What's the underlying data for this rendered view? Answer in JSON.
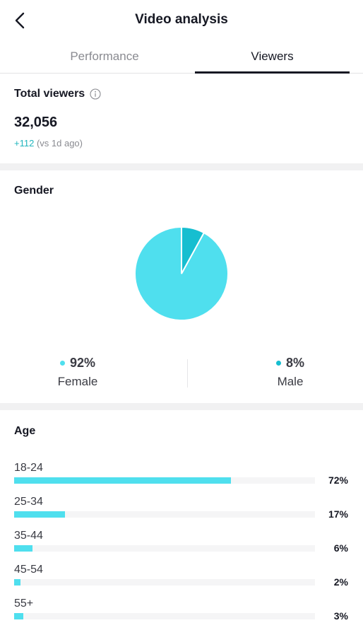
{
  "header": {
    "title": "Video analysis",
    "back_icon": "back-arrow-icon"
  },
  "tabs": [
    {
      "label": "Performance",
      "active": false
    },
    {
      "label": "Viewers",
      "active": true
    }
  ],
  "total_viewers": {
    "label": "Total viewers",
    "info_icon": "info-icon",
    "value": "32,056",
    "delta": "+112",
    "delta_note": "(vs 1d ago)"
  },
  "gender": {
    "title": "Gender",
    "colors": {
      "female": "#4fdfee",
      "male": "#16bed0"
    },
    "female": {
      "percent": "92%",
      "label": "Female",
      "value": 92
    },
    "male": {
      "percent": "8%",
      "label": "Male",
      "value": 8
    }
  },
  "age": {
    "title": "Age",
    "bar_color": "#4fdfee",
    "groups": [
      {
        "label": "18-24",
        "percent": "72%",
        "value": 72
      },
      {
        "label": "25-34",
        "percent": "17%",
        "value": 17
      },
      {
        "label": "35-44",
        "percent": "6%",
        "value": 6
      },
      {
        "label": "45-54",
        "percent": "2%",
        "value": 2
      },
      {
        "label": "55+",
        "percent": "3%",
        "value": 3
      }
    ]
  }
}
